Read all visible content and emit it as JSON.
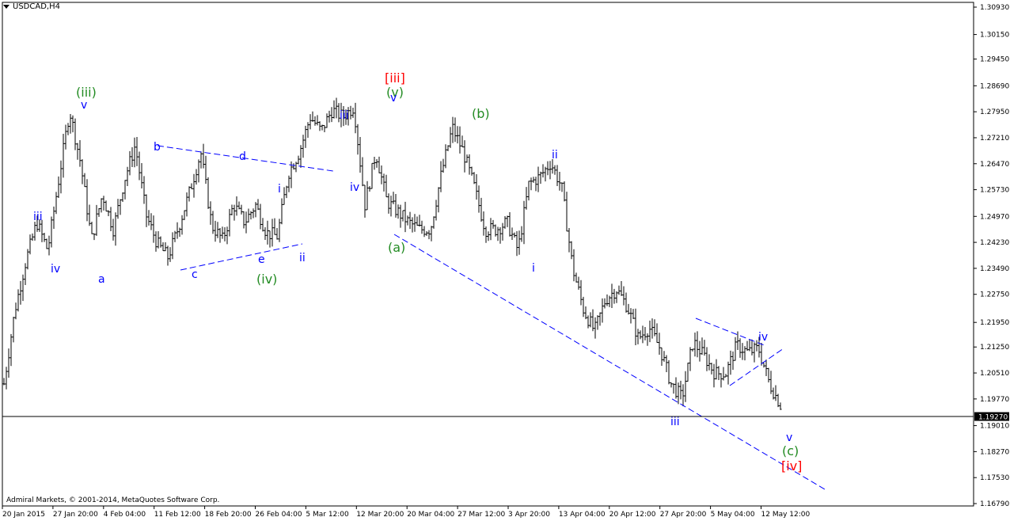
{
  "chart_data": {
    "type": "bar",
    "subtype": "ohlc",
    "title": "USDCAD,H4",
    "yaxis": {
      "ticks": [
        "1.30930",
        "1.30150",
        "1.29450",
        "1.28690",
        "1.27950",
        "1.27210",
        "1.26470",
        "1.25730",
        "1.24970",
        "1.24230",
        "1.23490",
        "1.22750",
        "1.21950",
        "1.21250",
        "1.20510",
        "1.19770",
        "1.19010",
        "1.18270",
        "1.17530",
        "1.16790"
      ],
      "ylim": [
        1.1679,
        1.3093
      ],
      "current_price": "1.19270"
    },
    "xaxis": {
      "ticks": [
        "20 Jan 2015",
        "27 Jan 20:00",
        "4 Feb 04:00",
        "11 Feb 12:00",
        "18 Feb 20:00",
        "26 Feb 04:00",
        "5 Mar 12:00",
        "12 Mar 20:00",
        "20 Mar 04:00",
        "27 Mar 12:00",
        "3 Apr 20:00",
        "13 Apr 04:00",
        "20 Apr 12:00",
        "27 Apr 20:00",
        "5 May 04:00",
        "12 May 12:00"
      ]
    },
    "price_path": [
      [
        0,
        1.202
      ],
      [
        1,
        1.223
      ],
      [
        2,
        1.237
      ],
      [
        3,
        1.248
      ],
      [
        4,
        1.24
      ],
      [
        5,
        1.26
      ],
      [
        6,
        1.28
      ],
      [
        7,
        1.265
      ],
      [
        8,
        1.243
      ],
      [
        9,
        1.256
      ],
      [
        10,
        1.246
      ],
      [
        11,
        1.26
      ],
      [
        12,
        1.27
      ],
      [
        13,
        1.25
      ],
      [
        14,
        1.242
      ],
      [
        15,
        1.238
      ],
      [
        16,
        1.247
      ],
      [
        17,
        1.257
      ],
      [
        18,
        1.268
      ],
      [
        19,
        1.247
      ],
      [
        20,
        1.243
      ],
      [
        21,
        1.253
      ],
      [
        22,
        1.248
      ],
      [
        23,
        1.253
      ],
      [
        24,
        1.245
      ],
      [
        25,
        1.244
      ],
      [
        26,
        1.262
      ],
      [
        27,
        1.268
      ],
      [
        28,
        1.278
      ],
      [
        29,
        1.274
      ],
      [
        30,
        1.28
      ],
      [
        31,
        1.278
      ],
      [
        32,
        1.281
      ],
      [
        33,
        1.253
      ],
      [
        34,
        1.268
      ],
      [
        35,
        1.254
      ],
      [
        36,
        1.251
      ],
      [
        37,
        1.248
      ],
      [
        38,
        1.246
      ],
      [
        39,
        1.246
      ],
      [
        40,
        1.262
      ],
      [
        41,
        1.275
      ],
      [
        42,
        1.268
      ],
      [
        43,
        1.258
      ],
      [
        44,
        1.246
      ],
      [
        45,
        1.246
      ],
      [
        46,
        1.248
      ],
      [
        47,
        1.24
      ],
      [
        48,
        1.259
      ],
      [
        49,
        1.261
      ],
      [
        50,
        1.265
      ],
      [
        51,
        1.258
      ],
      [
        52,
        1.235
      ],
      [
        53,
        1.223
      ],
      [
        54,
        1.217
      ],
      [
        55,
        1.226
      ],
      [
        56,
        1.229
      ],
      [
        57,
        1.224
      ],
      [
        58,
        1.215
      ],
      [
        59,
        1.218
      ],
      [
        60,
        1.212
      ],
      [
        61,
        1.202
      ],
      [
        62,
        1.198
      ],
      [
        63,
        1.214
      ],
      [
        64,
        1.21
      ],
      [
        65,
        1.205
      ],
      [
        66,
        1.205
      ],
      [
        67,
        1.213
      ],
      [
        68,
        1.211
      ],
      [
        69,
        1.212
      ],
      [
        70,
        1.202
      ],
      [
        71,
        1.196
      ]
    ],
    "wave_labels": [
      {
        "text": "(iii)",
        "color": "#228b22",
        "big": true
      },
      {
        "text": "v",
        "color": "#0000ff"
      },
      {
        "text": "iii",
        "color": "#0000ff"
      },
      {
        "text": "iv",
        "color": "#0000ff"
      },
      {
        "text": "a",
        "color": "#0000ff"
      },
      {
        "text": "b",
        "color": "#0000ff"
      },
      {
        "text": "c",
        "color": "#0000ff"
      },
      {
        "text": "d",
        "color": "#0000ff"
      },
      {
        "text": "e",
        "color": "#0000ff"
      },
      {
        "text": "(iv)",
        "color": "#228b22",
        "big": true
      },
      {
        "text": "i",
        "color": "#0000ff"
      },
      {
        "text": "ii",
        "color": "#0000ff"
      },
      {
        "text": "iii",
        "color": "#0000ff"
      },
      {
        "text": "iv",
        "color": "#0000ff"
      },
      {
        "text": "[iii]",
        "color": "#ff0000",
        "big": true
      },
      {
        "text": "(v)",
        "color": "#228b22",
        "big": true
      },
      {
        "text": "v",
        "color": "#0000ff"
      },
      {
        "text": "(a)",
        "color": "#228b22",
        "big": true
      },
      {
        "text": "(b)",
        "color": "#228b22",
        "big": true
      },
      {
        "text": "ii",
        "color": "#0000ff"
      },
      {
        "text": "i",
        "color": "#0000ff"
      },
      {
        "text": "iii",
        "color": "#0000ff"
      },
      {
        "text": "iv",
        "color": "#0000ff"
      },
      {
        "text": "v",
        "color": "#0000ff"
      },
      {
        "text": "(c)",
        "color": "#228b22",
        "big": true
      },
      {
        "text": "[iv]",
        "color": "#ff0000",
        "big": true
      }
    ],
    "colors": {
      "bars": "#000000",
      "trendlines": "#0000ff",
      "axis_text": "#000000"
    },
    "grid": false
  },
  "footer": {
    "copyright": "Admiral Markets, © 2001-2014, MetaQuotes Software Corp."
  }
}
